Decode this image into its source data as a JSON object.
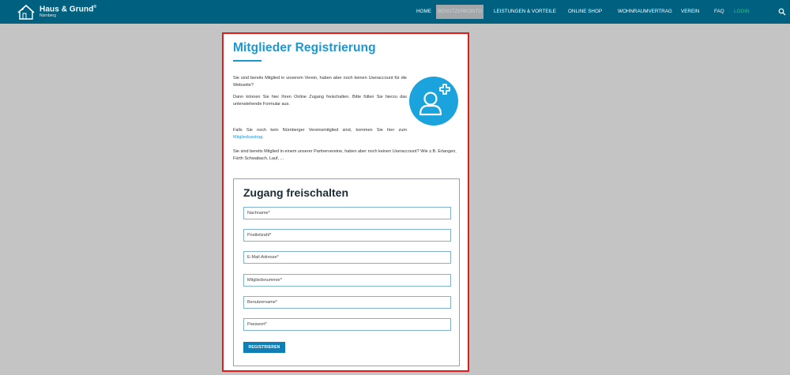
{
  "brand": {
    "name": "Haus & Grund",
    "registered": "®",
    "city": "Nürnberg"
  },
  "nav": {
    "items": [
      "HOME",
      "BENUTZERKONTO",
      "LEISTUNGEN & VORTEILE",
      "ONLINE SHOP",
      "WOHNRAUMVERTRAG",
      "VEREIN",
      "FAQ",
      "LOGIN"
    ],
    "active": "BENUTZERKONTO",
    "colors": {
      "bar": "#00607f",
      "active": "#a3a7a9",
      "login": "#2ecc71"
    }
  },
  "page": {
    "title": "Mitglieder Registrierung",
    "para1": "Sie sind bereits Mitglied in unserem Verein, haben aber noch keinen Useraccount für die Webseite?",
    "para2": "Dann können Sie hier Ihren Online Zugang freischalten. Bitte füllen Sie hierzu das untenstehende Formular aus.",
    "para3_prefix": "Falls Sie noch kein Nürnberger Vereinsmitglied sind, kommen Sie hier zum",
    "para3_link": "Mitgliedsantrag",
    "para3_suffix": ".",
    "para4": "Sie sind bereits Mitglied in einem unserer Partnervereine, haben aber noch keinen Useraccount? Wie z.B. Erlangen, Fürth Schwabach, Lauf, ...",
    "accent": "#1a98d5",
    "icon": "user-add-icon"
  },
  "form": {
    "title": "Zugang freischalten",
    "fields": {
      "nachname": "Nachname*",
      "postleitzahl": "Postleitzahl*",
      "email": "E-Mail-Adresse*",
      "mitgliedsnummer": "Mitgliedsnummer*",
      "benutzername": "Benutzername*",
      "passwort": "Passwort*"
    },
    "submit": "REGISTRIEREN"
  }
}
